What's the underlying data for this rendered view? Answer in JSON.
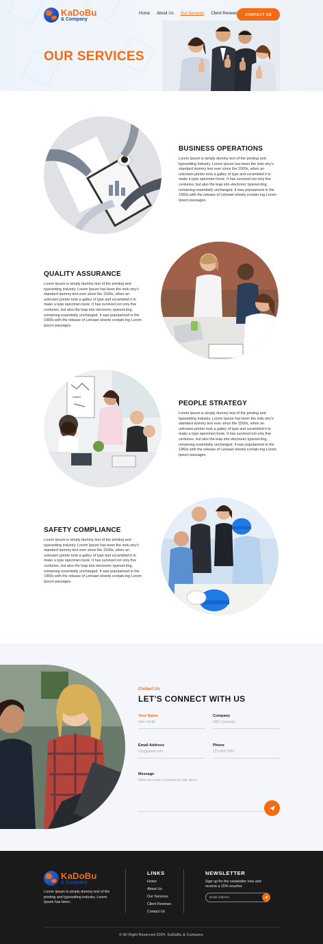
{
  "brand": {
    "name": "KaDoBu",
    "sub": "& Company"
  },
  "nav": {
    "items": [
      "Home",
      "About Us",
      "Our Services",
      "Client Reviews"
    ],
    "active": "Our Services",
    "cta": "CONTACT US"
  },
  "hero": {
    "title": "OUR SERVICES"
  },
  "services": [
    {
      "title": "BUSINESS OPERATIONS",
      "body": "Lorem Ipsum is simply dummy text of the printing and typesetting industry. Lorem Ipsum has been the indu stry's standard dummy text ever since the 1500s, when an unknown printer took a galley of type and scrambled it to make a type specimen book. It has survived not only five centuries, but also the leap into electronic typeset-ting, remaining essentially unchanged. It was popularised in the 1960s with the release of Letraset sheets contain-ing Lorem Ipsum passages."
    },
    {
      "title": "QUALITY ASSURANCE",
      "body": "Lorem Ipsum is simply dummy text of the printing and typesetting industry. Lorem Ipsum has been the indu stry's standard dummy text ever since the 1500s, when an unknown printer took a galley of type and scrambled it to make a type specimen book. It has survived not only five centuries, but also the leap into electronic typeset-ting, remaining essentially unchanged. It was popularised in the 1960s with the release of Letraset sheets contain-ing Lorem Ipsum passages."
    },
    {
      "title": "PEOPLE STRATEGY",
      "body": "Lorem Ipsum is simply dummy text of the printing and typesetting industry. Lorem Ipsum has been the indu stry's standard dummy text ever since the 1500s, when an unknown printer took a galley of type and scrambled it to make a type specimen book. It has survived not only five centuries, but also the leap into electronic typeset-ting, remaining essentially unchanged. It was popularised in the 1960s with the release of Letraset sheets contain-ing Lorem Ipsum passages."
    },
    {
      "title": "SAFETY COMPLIANCE",
      "body": "Lorem Ipsum is simply dummy text of the printing and typesetting industry. Lorem Ipsum has been the indu stry's standard dummy text ever since the 1500s, when an unknown printer took a galley of type and scrambled it to make a type specimen book. It has survived not only five centuries, but also the leap into electronic typeset-ting, remaining essentially unchanged. It was popularised in the 1960s with the release of Letraset sheets contain-ing Lorem Ipsum passages."
    }
  ],
  "contact": {
    "eyebrow": "Contact Us",
    "title": "LET'S CONNECT WITH US",
    "fields": {
      "name": {
        "label": "Your Name",
        "placeholder": "John Smith"
      },
      "company": {
        "label": "Company",
        "placeholder": "ABC Company"
      },
      "email": {
        "label": "Email Address",
        "placeholder": "info@gmail.com"
      },
      "phone": {
        "label": "Phone",
        "placeholder": "123-456-7890"
      },
      "message": {
        "label": "Message",
        "placeholder": "Hello you have a moment to talk about"
      }
    }
  },
  "footer": {
    "description": "Lorem Ipsum is simply dummy text of the printing and typesetting industry. Lorem Ipsum has been..",
    "links_heading": "LINKS",
    "links": [
      "Home",
      "About Us",
      "Our Services",
      "Client Reviews",
      "Contact Us"
    ],
    "newsletter_heading": "NEWSLETTER",
    "newsletter_text": "Sign up for the newsletter now and receive a 15% voucher.",
    "email_placeholder": "Email Address",
    "copyright": "© All Right Reserved 2024. KaDaBu & Company."
  },
  "colors": {
    "accent": "#f36b12",
    "brand_blue": "#1e44a8",
    "footer_bg": "#1a1a1a",
    "contact_bg": "#f5f6fb"
  }
}
